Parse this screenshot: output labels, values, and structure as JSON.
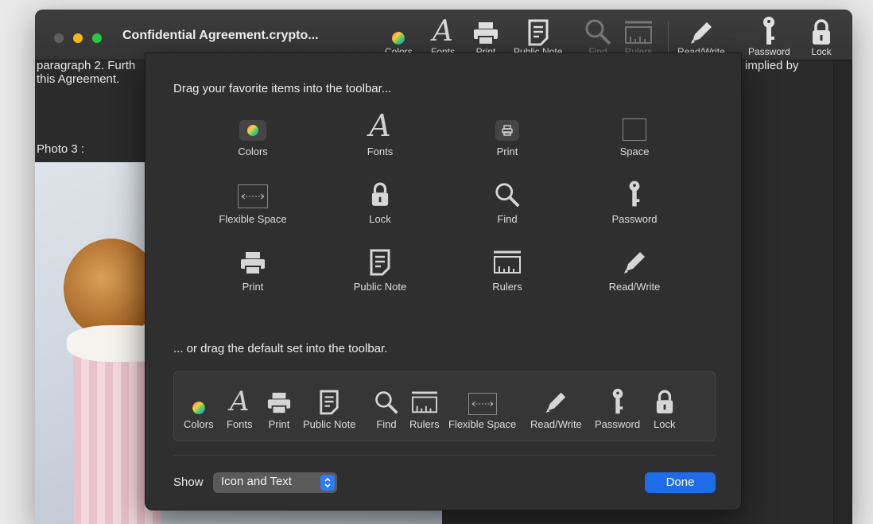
{
  "window": {
    "title": "Confidential Agreement.crypto..."
  },
  "toolbar": {
    "items": [
      {
        "label": "Colors",
        "icon": "color-wheel-icon"
      },
      {
        "label": "Fonts",
        "icon": "font-icon"
      },
      {
        "label": "Print",
        "icon": "printer-icon"
      },
      {
        "label": "Public Note",
        "icon": "note-icon"
      },
      {
        "label": "Find",
        "icon": "magnifier-icon"
      },
      {
        "label": "Rulers",
        "icon": "ruler-icon"
      },
      {
        "label": "Read/Write",
        "icon": "pencil-icon"
      },
      {
        "label": "Password",
        "icon": "key-icon"
      },
      {
        "label": "Lock",
        "icon": "lock-icon"
      }
    ]
  },
  "document": {
    "line1": "paragraph 2. Furth",
    "line2": "this Agreement.",
    "photo_label": "Photo 3 :",
    "right_text": "implied by"
  },
  "sheet": {
    "heading": "Drag your favorite items into the toolbar...",
    "items": [
      {
        "label": "Colors",
        "icon": "color-wheel-icon"
      },
      {
        "label": "Fonts",
        "icon": "font-icon"
      },
      {
        "label": "Print",
        "icon": "print-small-icon"
      },
      {
        "label": "Space",
        "icon": "space-icon"
      },
      {
        "label": "Flexible Space",
        "icon": "flexible-space-icon"
      },
      {
        "label": "Lock",
        "icon": "lock-icon"
      },
      {
        "label": "Find",
        "icon": "magnifier-icon"
      },
      {
        "label": "Password",
        "icon": "key-icon"
      },
      {
        "label": "Print",
        "icon": "printer-icon"
      },
      {
        "label": "Public Note",
        "icon": "note-icon"
      },
      {
        "label": "Rulers",
        "icon": "ruler-icon"
      },
      {
        "label": "Read/Write",
        "icon": "pencil-icon"
      }
    ],
    "default_heading": "... or drag the default set into the toolbar.",
    "default_items": [
      {
        "label": "Colors"
      },
      {
        "label": "Fonts"
      },
      {
        "label": "Print"
      },
      {
        "label": "Public Note"
      },
      {
        "label": "Find"
      },
      {
        "label": "Rulers"
      },
      {
        "label": "Flexible Space"
      },
      {
        "label": "Read/Write"
      },
      {
        "label": "Password"
      },
      {
        "label": "Lock"
      }
    ],
    "show_label": "Show",
    "show_value": "Icon and Text",
    "done_label": "Done"
  },
  "colors": {
    "accent": "#1f6ce8",
    "sheet_bg": "#2f2f2f"
  }
}
